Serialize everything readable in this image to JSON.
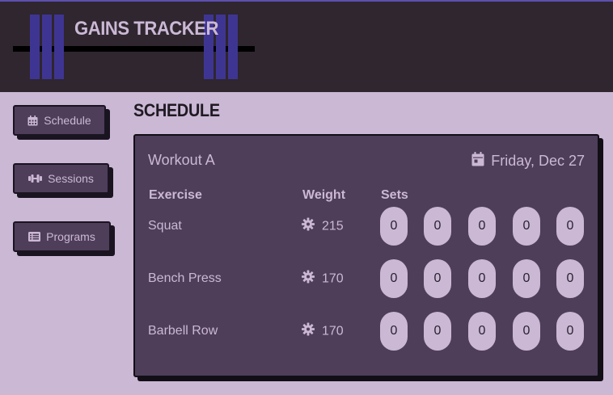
{
  "app": {
    "title": "GAINS TRACKER"
  },
  "nav": {
    "items": [
      {
        "label": "Schedule",
        "icon": "calendar-icon"
      },
      {
        "label": "Sessions",
        "icon": "dumbbell-icon"
      },
      {
        "label": "Programs",
        "icon": "list-icon"
      }
    ]
  },
  "section": {
    "title": "SCHEDULE"
  },
  "workout": {
    "name": "Workout A",
    "date": "Friday, Dec 27",
    "date_icon": "calendar-icon",
    "weight_icon": "gear-icon",
    "headers": {
      "exercise": "Exercise",
      "weight": "Weight",
      "sets": "Sets"
    },
    "exercises": [
      {
        "name": "Squat",
        "weight": "215",
        "sets": [
          "0",
          "0",
          "0",
          "0",
          "0"
        ]
      },
      {
        "name": "Bench Press",
        "weight": "170",
        "sets": [
          "0",
          "0",
          "0",
          "0",
          "0"
        ]
      },
      {
        "name": "Barbell Row",
        "weight": "170",
        "sets": [
          "0",
          "0",
          "0",
          "0",
          "0"
        ]
      }
    ]
  },
  "colors": {
    "header_bg": "#2f262f",
    "page_bg": "#cbb8d5",
    "card_bg": "#4e3e5a",
    "accent": "#3e3593",
    "text_light": "#cbb8d5"
  }
}
